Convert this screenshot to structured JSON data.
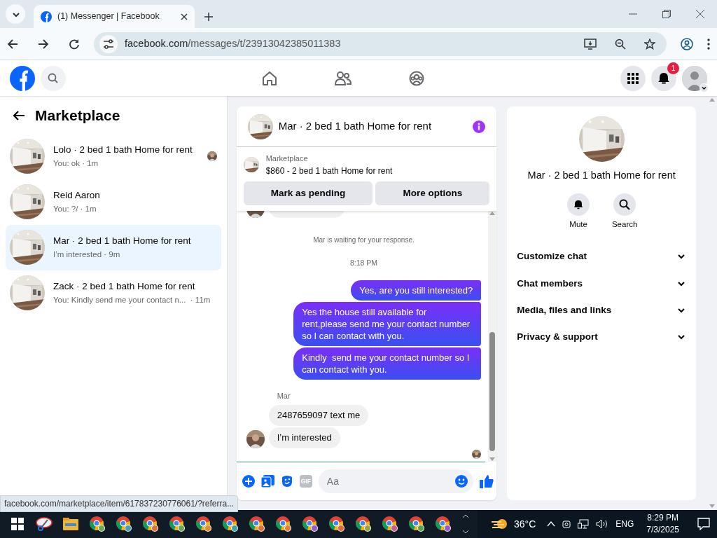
{
  "browser": {
    "tab_title": "(1) Messenger | Facebook",
    "url_domain": "facebook.com",
    "url_path": "/messages/t/23913042385011383"
  },
  "header": {
    "notification_badge": "1"
  },
  "sidebar": {
    "title": "Marketplace",
    "conversations": [
      {
        "name": "Lolo · 2 bed 1 bath Home for rent",
        "preview": "You: ok · 1m",
        "selected": false,
        "seen": true
      },
      {
        "name": "Reid Aaron",
        "preview": "You: ?/ · 1m",
        "selected": false,
        "seen": false
      },
      {
        "name": "Mar · 2 bed 1 bath Home for rent",
        "preview": "I’m interested · 9m",
        "selected": true,
        "seen": false
      },
      {
        "name": "Zack · 2 bed 1 bath Home for rent",
        "preview": "You: Kindly send me your contact n...  · 11m",
        "selected": false,
        "seen": false
      }
    ]
  },
  "chat": {
    "title": "Mar · 2 bed 1 bath Home for rent",
    "listing": {
      "label": "Marketplace",
      "text": "$860 - 2 bed 1 bath Home for rent"
    },
    "buttons": [
      "Mark as pending",
      "More options"
    ],
    "messages": [
      {
        "kind": "clipped",
        "avatar": true
      },
      {
        "kind": "notice",
        "text": "Mar is waiting for your response."
      },
      {
        "kind": "time",
        "text": "8:18 PM"
      },
      {
        "kind": "outgoing",
        "text": "Yes, are you still interested?"
      },
      {
        "kind": "outgoing",
        "text": "Yes the house still available for rent,please send me your contact number so I can contact with you."
      },
      {
        "kind": "outgoing",
        "text": "Kindly  send me your contact number so I can contact with you."
      },
      {
        "kind": "sender",
        "text": "Mar"
      },
      {
        "kind": "incoming",
        "text": "2487659097 text me",
        "avatar": false
      },
      {
        "kind": "incoming",
        "text": "I’m interested",
        "avatar": true
      },
      {
        "kind": "seen"
      }
    ],
    "composer": {
      "gif_label": "GIF",
      "placeholder": "Aa"
    }
  },
  "details": {
    "title": "Mar · 2 bed 1 bath Home for rent",
    "actions": [
      {
        "kind": "bell",
        "label": "Mute"
      },
      {
        "kind": "search",
        "label": "Search"
      }
    ],
    "sections": [
      "Customize chat",
      "Chat members",
      "Media, files and links",
      "Privacy & support"
    ]
  },
  "status_url": "facebook.com/marketplace/item/617837230776061/?referra...",
  "taskbar": {
    "apps": [
      {
        "color": "#6aa84f"
      },
      {
        "color": "#4a9fb0"
      },
      {
        "color": "#e0703a"
      },
      {
        "color": "#6aa84f"
      },
      {
        "color": "#e08a3a"
      },
      {
        "color": "#3fa3a8"
      },
      {
        "color": "#e0703a"
      },
      {
        "color": "#e0803a"
      },
      {
        "color": "#9b59d0"
      },
      {
        "color": "#e06a3a"
      },
      {
        "color": "#a0a040"
      },
      {
        "color": "#d05a8a"
      },
      {
        "color": "#5aa050"
      },
      {
        "color": "#9b59d0"
      }
    ],
    "temperature": "36°C",
    "language": "ENG",
    "time": "8:29 PM",
    "date": "7/3/2025"
  }
}
